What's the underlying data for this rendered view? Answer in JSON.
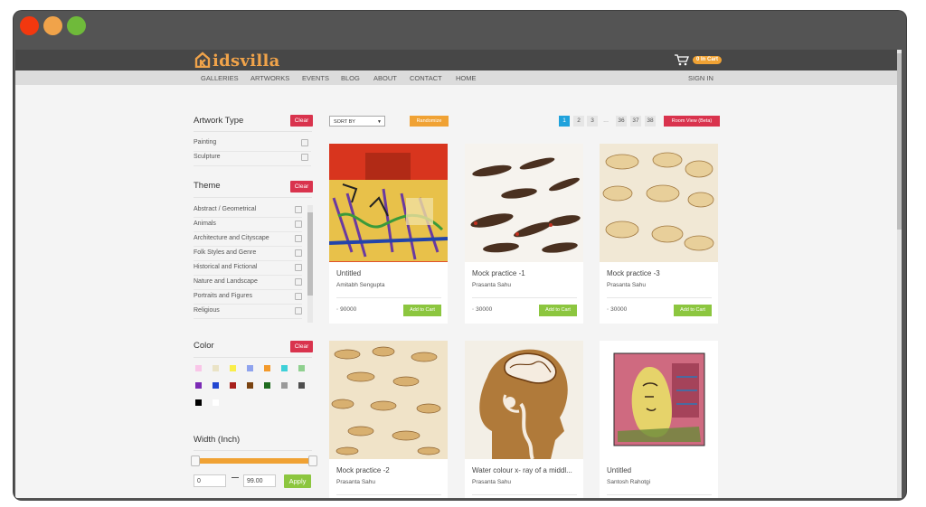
{
  "window": {
    "controls": [
      {
        "name": "close",
        "color": "#f2380f"
      },
      {
        "name": "minimize",
        "color": "#f0a34a"
      },
      {
        "name": "maximize",
        "color": "#6fba3a"
      }
    ]
  },
  "header": {
    "logo_text": "idsvilla",
    "cart_badge": "0 In Cart"
  },
  "nav": {
    "items": [
      "GALLERIES",
      "ARTWORKS",
      "EVENTS",
      "BLOG",
      "ABOUT",
      "CONTACT",
      "HOME"
    ],
    "signin": "SIGN IN"
  },
  "sidebar": {
    "artwork_type": {
      "title": "Artwork Type",
      "clear": "Clear",
      "options": [
        "Painting",
        "Sculpture"
      ]
    },
    "theme": {
      "title": "Theme",
      "clear": "Clear",
      "options": [
        "Abstract / Geometrical",
        "Animals",
        "Architecture and Cityscape",
        "Folk Styles and Genre",
        "Historical and Fictional",
        "Nature and Landscape",
        "Portraits and Figures",
        "Religious"
      ]
    },
    "color": {
      "title": "Color",
      "clear": "Clear",
      "swatches": [
        "#f9c6e8",
        "#eae3c6",
        "#f9ee4a",
        "#8fa3ee",
        "#f39a2b",
        "#3ed0d8",
        "#8fd08f",
        "#7b2bb5",
        "#2247d1",
        "#a8201b",
        "#7a4311",
        "#1e6b1e",
        "#9a9a9a",
        "#4e4e4e",
        "#000000",
        "#ffffff"
      ]
    },
    "width": {
      "title": "Width (Inch)",
      "min": "0",
      "max": "99.00",
      "apply": "Apply",
      "range_low_fraction": 0.0,
      "range_high_fraction": 1.0
    }
  },
  "toolbar": {
    "sort_by": "SORT BY",
    "randomize": "Randomize",
    "pages": [
      "1",
      "2",
      "3",
      "36",
      "37",
      "38"
    ],
    "ellipsis": "...",
    "current_page": "1",
    "room_view": "Room View (Beta)"
  },
  "products": [
    {
      "title": "Untitled",
      "artist": "Amitabh Sengupta",
      "price": "90000",
      "add": "Add to Cart"
    },
    {
      "title": "Mock practice -1",
      "artist": "Prasanta Sahu",
      "price": "30000",
      "add": "Add to Cart"
    },
    {
      "title": "Mock practice -3",
      "artist": "Prasanta Sahu",
      "price": "30000",
      "add": "Add to Cart"
    },
    {
      "title": "Mock practice -2",
      "artist": "Prasanta Sahu",
      "price": "",
      "add": ""
    },
    {
      "title": "Water colour x- ray of a middl...",
      "artist": "Prasanta Sahu",
      "price": "",
      "add": ""
    },
    {
      "title": "Untitled",
      "artist": "Santosh Rahotgi",
      "price": "",
      "add": ""
    }
  ]
}
